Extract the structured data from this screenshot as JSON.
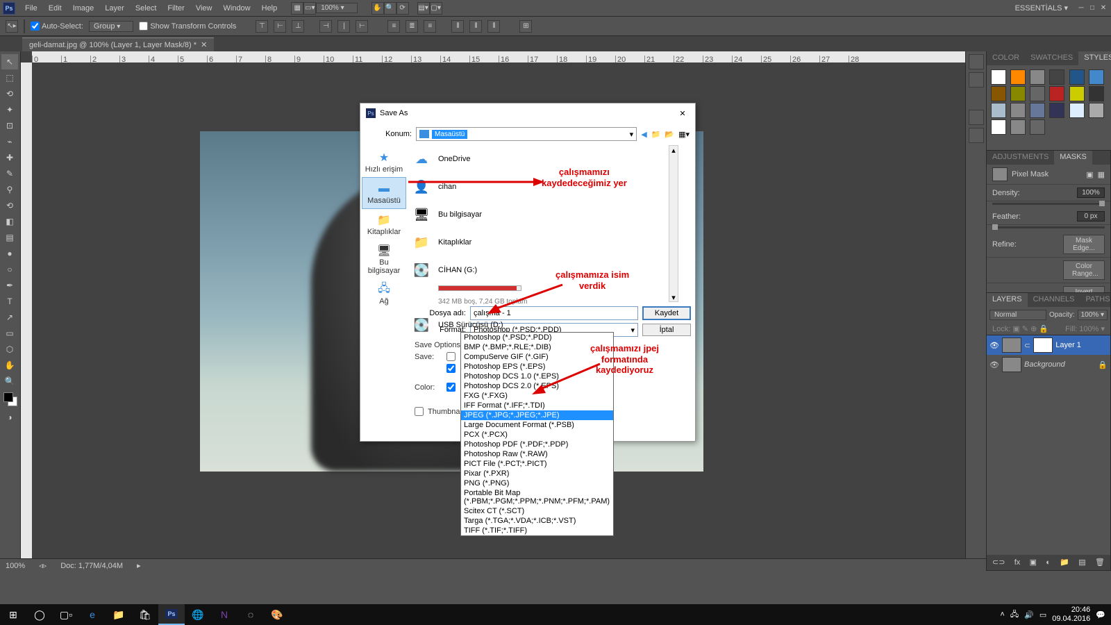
{
  "menubar": {
    "items": [
      "File",
      "Edit",
      "Image",
      "Layer",
      "Select",
      "Filter",
      "View",
      "Window",
      "Help"
    ],
    "zoom": "100% ▾",
    "essentials": "ESSENTİALS ▾"
  },
  "optionbar": {
    "autoSelect": "Auto-Select:",
    "autoSelectVal": "Group",
    "showTransform": "Show Transform Controls"
  },
  "tab": {
    "title": "geli-damat.jpg @ 100% (Layer 1, Layer Mask/8) *"
  },
  "ruler": [
    "0",
    "1",
    "2",
    "3",
    "4",
    "5",
    "6",
    "7",
    "8",
    "9",
    "10",
    "11",
    "12",
    "13",
    "14",
    "15",
    "16",
    "17",
    "18",
    "19",
    "20",
    "21",
    "22",
    "23",
    "24",
    "25",
    "26",
    "27",
    "28"
  ],
  "dialog": {
    "title": "Save As",
    "locationLabel": "Konum:",
    "locationVal": "Masaüstü",
    "places": [
      "Hızlı erişim",
      "Masaüstü",
      "Kitaplıklar",
      "Bu bilgisayar",
      "Ağ"
    ],
    "files": [
      "OneDrive",
      "cihan",
      "Bu bilgisayar",
      "Kitaplıklar",
      "CİHAN (G:)",
      "USB Sürücüsü (D:)"
    ],
    "driveInfo": "342 MB boş, 7,24 GB toplam",
    "fileLabel": "Dosya adı:",
    "fileVal": "çalışma - 1",
    "formatLabel": "Format:",
    "formatVal": "Photoshop (*.PSD;*.PDD)",
    "save": "Kaydet",
    "cancel": "İptal",
    "saveOptionsLabel": "Save Options",
    "saveLabel": "Save:",
    "colorLabel": "Color:",
    "thumbLabel": "Thumbnail",
    "formats": [
      "Photoshop (*.PSD;*.PDD)",
      "BMP (*.BMP;*.RLE;*.DIB)",
      "CompuServe GIF (*.GIF)",
      "Photoshop EPS (*.EPS)",
      "Photoshop DCS 1.0 (*.EPS)",
      "Photoshop DCS 2.0 (*.EPS)",
      "FXG (*.FXG)",
      "IFF Format (*.IFF;*.TDI)",
      "JPEG (*.JPG;*.JPEG;*.JPE)",
      "Large Document Format (*.PSB)",
      "PCX (*.PCX)",
      "Photoshop PDF (*.PDF;*.PDP)",
      "Photoshop Raw (*.RAW)",
      "PICT File (*.PCT;*.PICT)",
      "Pixar (*.PXR)",
      "PNG (*.PNG)",
      "Portable Bit Map (*.PBM;*.PGM;*.PPM;*.PNM;*.PFM;*.PAM)",
      "Scitex CT (*.SCT)",
      "Targa (*.TGA;*.VDA;*.ICB;*.VST)",
      "TIFF (*.TIF;*.TIFF)"
    ]
  },
  "annot": {
    "loc": "çalışmamızı\nkaydedeceğimiz yer",
    "name": "çalışmamıza isim\nverdik",
    "fmt": "çalışmamızı jpej\nformatında\nkaydediyoruz"
  },
  "panels": {
    "colorTabs": [
      "COLOR",
      "SWATCHES",
      "STYLES"
    ],
    "adjTabs": [
      "ADJUSTMENTS",
      "MASKS"
    ],
    "pixelMask": "Pixel Mask",
    "density": "Density:",
    "densityVal": "100%",
    "feather": "Feather:",
    "featherVal": "0 px",
    "refine": "Refine:",
    "maskEdge": "Mask Edge...",
    "colorRange": "Color Range...",
    "invert": "Invert",
    "layerTabs": [
      "LAYERS",
      "CHANNELS",
      "PATHS"
    ],
    "blendMode": "Normal",
    "opacity": "Opacity:",
    "opacityVal": "100% ▾",
    "lock": "Lock:",
    "fill": "Fill:",
    "fillVal": "100% ▾",
    "layers": [
      "Layer 1",
      "Background"
    ]
  },
  "status": {
    "zoom": "100%",
    "doc": "Doc: 1,77M/4,04M"
  },
  "tray": {
    "time": "20:46",
    "date": "09.04.2016"
  }
}
